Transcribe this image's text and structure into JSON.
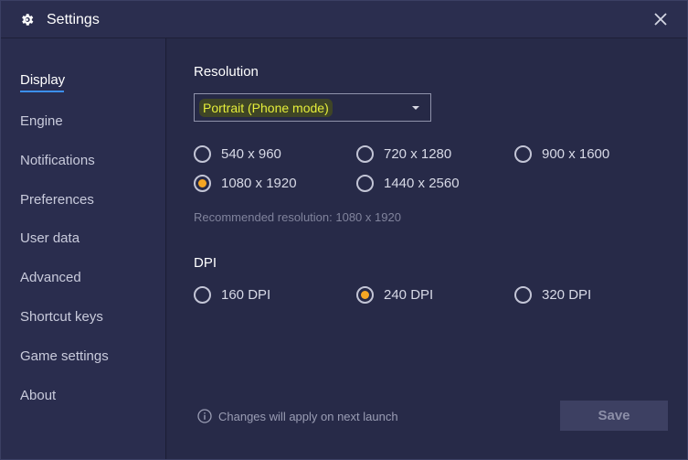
{
  "window": {
    "title": "Settings"
  },
  "sidebar": {
    "items": [
      {
        "label": "Display",
        "active": true
      },
      {
        "label": "Engine"
      },
      {
        "label": "Notifications"
      },
      {
        "label": "Preferences"
      },
      {
        "label": "User data"
      },
      {
        "label": "Advanced"
      },
      {
        "label": "Shortcut keys"
      },
      {
        "label": "Game settings"
      },
      {
        "label": "About"
      }
    ]
  },
  "resolution": {
    "heading": "Resolution",
    "mode_selected": "Portrait (Phone mode)",
    "options": [
      {
        "label": "540 x 960",
        "checked": false
      },
      {
        "label": "720 x 1280",
        "checked": false
      },
      {
        "label": "900 x 1600",
        "checked": false
      },
      {
        "label": "1080 x 1920",
        "checked": true
      },
      {
        "label": "1440 x 2560",
        "checked": false
      }
    ],
    "recommended": "Recommended resolution: 1080 x 1920"
  },
  "dpi": {
    "heading": "DPI",
    "options": [
      {
        "label": "160 DPI",
        "checked": false
      },
      {
        "label": "240 DPI",
        "checked": true
      },
      {
        "label": "320 DPI",
        "checked": false
      }
    ]
  },
  "footer": {
    "note": "Changes will apply on next launch",
    "save_label": "Save"
  },
  "colors": {
    "radio_checked": "#f5a623",
    "active_underline": "#3c8ff0",
    "highlight_text": "#e5ee3a"
  }
}
